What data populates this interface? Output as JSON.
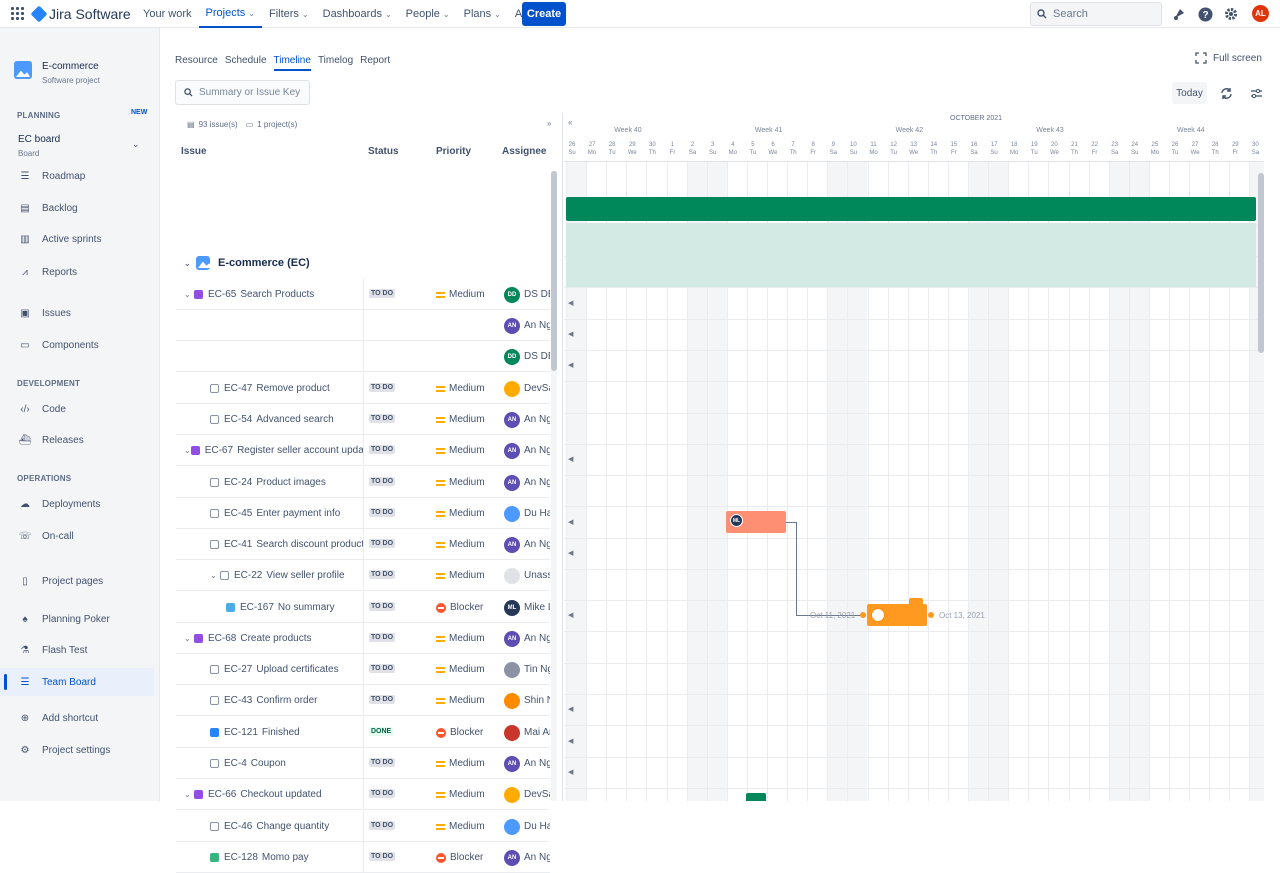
{
  "topnav": {
    "brand": "Jira Software",
    "items": [
      "Your work",
      "Projects",
      "Filters",
      "Dashboards",
      "People",
      "Plans",
      "Apps"
    ],
    "active": "Projects",
    "create": "Create",
    "search_placeholder": "Search",
    "user_initials": "AL"
  },
  "sidebar": {
    "project_name": "E-commerce",
    "project_type": "Software project",
    "planning": "PLANNING",
    "new_badge": "NEW",
    "board_name": "EC board",
    "board_sub": "Board",
    "planning_items": [
      "Roadmap",
      "Backlog",
      "Active sprints",
      "Reports"
    ],
    "other_items": [
      "Issues",
      "Components"
    ],
    "development": "DEVELOPMENT",
    "dev_items": [
      "Code",
      "Releases"
    ],
    "operations": "OPERATIONS",
    "ops_items": [
      "Deployments",
      "On-call"
    ],
    "bottom_items": [
      "Project pages",
      "Planning Poker",
      "Flash Test",
      "Team Board",
      "Add shortcut",
      "Project settings"
    ],
    "active": "Team Board"
  },
  "main": {
    "tabs": [
      "Resource",
      "Schedule",
      "Timeline",
      "Timelog",
      "Report"
    ],
    "active_tab": "Timeline",
    "fullscreen": "Full screen",
    "filter_placeholder": "Summary or Issue Key",
    "today": "Today",
    "issue_count": "93 issue(s)",
    "project_count": "1 project(s)",
    "col_issue": "Issue",
    "col_status": "Status",
    "col_priority": "Priority",
    "col_assignee": "Assignee",
    "epic_name": "E-commerce (EC)"
  },
  "rows": [
    {
      "key": "EC-65",
      "title": "Search Products",
      "type": "epic",
      "level": 0,
      "status": "TO DO",
      "priority": "Medium",
      "assignee": "DS DE",
      "initials": "DD",
      "color": "#00875A"
    },
    {
      "key": "",
      "title": "",
      "type": "",
      "level": 0,
      "status": "",
      "priority": "",
      "assignee": "An Ng",
      "initials": "AN",
      "color": "#5E4DB2"
    },
    {
      "key": "",
      "title": "",
      "type": "",
      "level": 0,
      "status": "",
      "priority": "",
      "assignee": "DS DE",
      "initials": "DD",
      "color": "#00875A"
    },
    {
      "key": "EC-47",
      "title": "Remove product",
      "type": "sub",
      "level": 1,
      "status": "TO DO",
      "priority": "Medium",
      "assignee": "DevSa",
      "initials": "",
      "color": "#FFAB00"
    },
    {
      "key": "EC-54",
      "title": "Advanced search",
      "type": "sub",
      "level": 1,
      "status": "TO DO",
      "priority": "Medium",
      "assignee": "An Ng",
      "initials": "AN",
      "color": "#5E4DB2"
    },
    {
      "key": "EC-67",
      "title": "Register seller account update",
      "type": "epic",
      "level": 0,
      "status": "TO DO",
      "priority": "Medium",
      "assignee": "An Ng",
      "initials": "AN",
      "color": "#5E4DB2"
    },
    {
      "key": "EC-24",
      "title": "Product images",
      "type": "sub",
      "level": 1,
      "status": "TO DO",
      "priority": "Medium",
      "assignee": "An Ng",
      "initials": "AN",
      "color": "#5E4DB2"
    },
    {
      "key": "EC-45",
      "title": "Enter payment info",
      "type": "sub",
      "level": 1,
      "status": "TO DO",
      "priority": "Medium",
      "assignee": "Du Ha",
      "initials": "",
      "color": "#4C9AFF"
    },
    {
      "key": "EC-41",
      "title": "Search discount products",
      "type": "sub",
      "level": 1,
      "status": "TO DO",
      "priority": "Medium",
      "assignee": "An Ng",
      "initials": "AN",
      "color": "#5E4DB2"
    },
    {
      "key": "EC-22",
      "title": "View seller profile",
      "type": "sub",
      "level": 1,
      "status": "TO DO",
      "priority": "Medium",
      "assignee": "Unassi",
      "initials": "",
      "color": "#DFE1E6",
      "collapsible": true
    },
    {
      "key": "EC-167",
      "title": "No summary",
      "type": "task",
      "level": 2,
      "status": "TO DO",
      "priority": "Blocker",
      "assignee": "Mike L",
      "initials": "ML",
      "color": "#253858"
    },
    {
      "key": "EC-68",
      "title": "Create products",
      "type": "epic",
      "level": 0,
      "status": "TO DO",
      "priority": "Medium",
      "assignee": "An Ng",
      "initials": "AN",
      "color": "#5E4DB2"
    },
    {
      "key": "EC-27",
      "title": "Upload certificates",
      "type": "sub",
      "level": 1,
      "status": "TO DO",
      "priority": "Medium",
      "assignee": "Tin Ng",
      "initials": "",
      "color": "#8993A4"
    },
    {
      "key": "EC-43",
      "title": "Confirm order",
      "type": "sub",
      "level": 1,
      "status": "TO DO",
      "priority": "Medium",
      "assignee": "Shin N",
      "initials": "",
      "color": "#FF8B00"
    },
    {
      "key": "EC-121",
      "title": "Finished",
      "type": "doneic",
      "level": 1,
      "status": "DONE",
      "priority": "Blocker",
      "assignee": "Mai Ar",
      "initials": "",
      "color": "#C9372C"
    },
    {
      "key": "EC-4",
      "title": "Coupon",
      "type": "sub",
      "level": 1,
      "status": "TO DO",
      "priority": "Medium",
      "assignee": "An Ng",
      "initials": "AN",
      "color": "#5E4DB2"
    },
    {
      "key": "EC-66",
      "title": "Checkout updated",
      "type": "epic",
      "level": 0,
      "status": "TO DO",
      "priority": "Medium",
      "assignee": "DevSa",
      "initials": "",
      "color": "#FFAB00"
    },
    {
      "key": "EC-46",
      "title": "Change quantity",
      "type": "sub",
      "level": 1,
      "status": "TO DO",
      "priority": "Medium",
      "assignee": "Du Ha",
      "initials": "",
      "color": "#4C9AFF"
    },
    {
      "key": "EC-128",
      "title": "Momo pay",
      "type": "story",
      "level": 1,
      "status": "TO DO",
      "priority": "Blocker",
      "assignee": "An Ng",
      "initials": "AN",
      "color": "#5E4DB2"
    }
  ],
  "timeline": {
    "month": "OCTOBER 2021",
    "weeks": [
      "Week 40",
      "Week 41",
      "Week 42",
      "Week 43",
      "Week 44"
    ],
    "day_nums": [
      "26",
      "27",
      "28",
      "29",
      "30",
      "1",
      "2",
      "3",
      "4",
      "5",
      "6",
      "7",
      "8",
      "9",
      "10",
      "11",
      "12",
      "13",
      "14",
      "15",
      "16",
      "17",
      "18",
      "19",
      "20",
      "21",
      "22",
      "23",
      "24",
      "25",
      "26",
      "27",
      "28",
      "29",
      "30",
      "31"
    ],
    "day_names": [
      "Su",
      "Mo",
      "Tu",
      "We",
      "Th",
      "Fr",
      "Sa",
      "Su",
      "Mo",
      "Tu",
      "We",
      "Th",
      "Fr",
      "Sa",
      "Su",
      "Mo",
      "Tu",
      "We",
      "Th",
      "Fr",
      "Sa",
      "Su",
      "Mo",
      "Tu",
      "We",
      "Th",
      "Fr",
      "Sa",
      "Su",
      "Mo",
      "Tu",
      "We",
      "Th",
      "Fr",
      "Sa",
      "Su"
    ],
    "bar_avatar_1": "ML",
    "start_label": "Oct 11, 2021",
    "end_label": "Oct 13, 2021"
  }
}
